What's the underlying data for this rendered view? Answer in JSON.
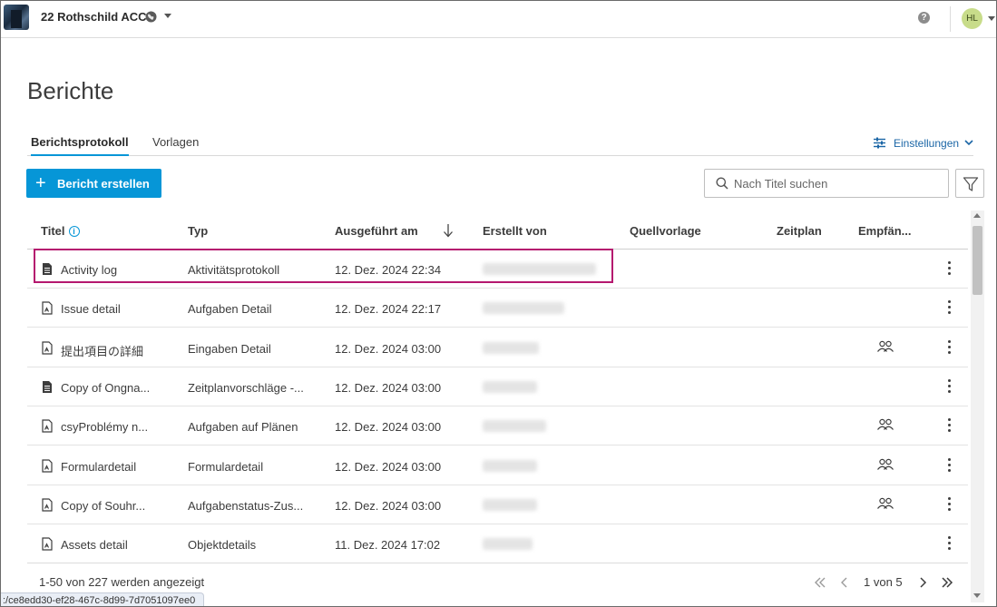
{
  "header": {
    "project_title": "22 Rothschild ACC",
    "avatar_initials": "HL",
    "help_glyph": "?"
  },
  "page": {
    "title": "Berichte"
  },
  "tabs": [
    {
      "label": "Berichtsprotokoll",
      "active": true
    },
    {
      "label": "Vorlagen",
      "active": false
    }
  ],
  "settings": {
    "label": "Einstellungen"
  },
  "toolbar": {
    "create_label": "Bericht erstellen",
    "create_glyph": "+",
    "search_placeholder": "Nach Titel suchen"
  },
  "table": {
    "columns": {
      "title": "Titel",
      "type": "Typ",
      "run": "Ausgeführt am",
      "creator": "Erstellt von",
      "source": "Quellvorlage",
      "schedule": "Zeitplan",
      "recipients": "Empfän..."
    },
    "info_glyph": "i",
    "rows": [
      {
        "title": "Activity log",
        "type": "Aktivitätsprotokoll",
        "run": "12. Dez. 2024 22:34",
        "recipients": false
      },
      {
        "title": "Issue detail",
        "type": "Aufgaben Detail",
        "run": "12. Dez. 2024 22:17",
        "recipients": false
      },
      {
        "title": "提出項目の詳細",
        "type": "Eingaben Detail",
        "run": "12. Dez. 2024 03:00",
        "recipients": true
      },
      {
        "title": "Copy of Ongna...",
        "type": "Zeitplanvorschläge -...",
        "run": "12. Dez. 2024 03:00",
        "recipients": false
      },
      {
        "title": "csyProblémy n...",
        "type": "Aufgaben auf Plänen",
        "run": "12. Dez. 2024 03:00",
        "recipients": true
      },
      {
        "title": "Formulardetail",
        "type": "Formulardetail",
        "run": "12. Dez. 2024 03:00",
        "recipients": true
      },
      {
        "title": "Copy of Souhr...",
        "type": "Aufgabenstatus-Zus...",
        "run": "12. Dez. 2024 03:00",
        "recipients": true
      },
      {
        "title": "Assets detail",
        "type": "Objektdetails",
        "run": "11. Dez. 2024 17:02",
        "recipients": false
      }
    ]
  },
  "footer": {
    "count_text": "1-50 von 227 werden angezeigt",
    "page_text": "1 von 5"
  },
  "status_bar": {
    "url": ":/ce8edd30-ef28-467c-8d99-7d7051097ee0"
  },
  "colors": {
    "accent": "#0696d7",
    "highlight": "#b5186f",
    "avatar_bg": "#c8dc8a"
  }
}
